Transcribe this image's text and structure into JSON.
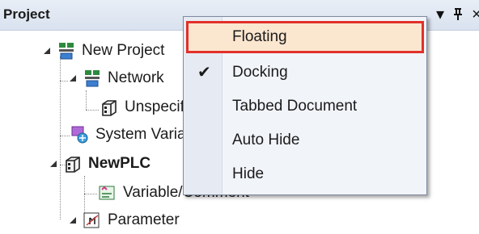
{
  "panel": {
    "title": "Project",
    "dropdown_glyph": "▾",
    "pin_glyph": "ᛒ",
    "close_glyph": "×"
  },
  "tree": {
    "project": {
      "label": "New Project",
      "icon": "project-icon"
    },
    "network": {
      "label": "Network",
      "icon": "network-icon"
    },
    "unspecified": {
      "label": "Unspecified",
      "icon": "plc-module-icon"
    },
    "system_variable": {
      "label": "System Variable",
      "icon": "system-variable-icon"
    },
    "newplc": {
      "label": "NewPLC",
      "icon": "plc-icon"
    },
    "variable_comment": {
      "label": "Variable/Comment",
      "icon": "variable-comment-icon"
    },
    "parameter": {
      "label": "Parameter",
      "icon": "parameter-icon"
    }
  },
  "context_menu": {
    "items": [
      {
        "label": "Floating",
        "checked": false,
        "highlighted": true
      },
      {
        "label": "Docking",
        "checked": true,
        "highlighted": false
      },
      {
        "label": "Tabbed Document",
        "checked": false,
        "highlighted": false
      },
      {
        "label": "Auto Hide",
        "checked": false,
        "highlighted": false
      },
      {
        "label": "Hide",
        "checked": false,
        "highlighted": false
      }
    ],
    "check_glyph": "✔",
    "highlight_border_color": "#e2302b",
    "highlight_fill_color": "#fbe6cf"
  }
}
